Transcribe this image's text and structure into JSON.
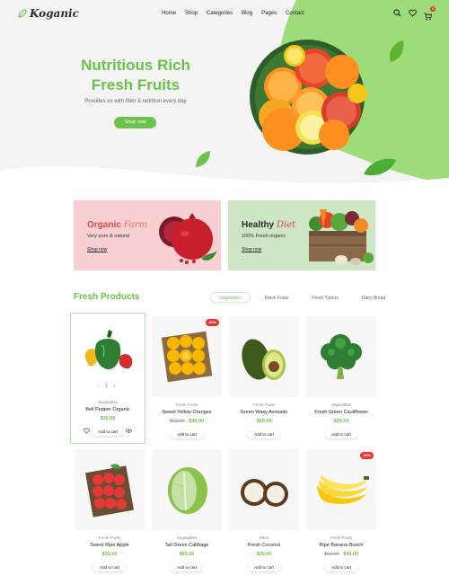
{
  "brand": {
    "name": "Koganic"
  },
  "nav": {
    "links": [
      "Home",
      "Shop",
      "Categories",
      "Blog",
      "Pages",
      "Contact"
    ],
    "cart_count": "0"
  },
  "hero": {
    "title_line1": "Nutritious Rich",
    "title_line2": "Fresh Fruits",
    "subtitle": "Provides us with fiber & nutrition every day",
    "button": "Shop now"
  },
  "banners": [
    {
      "title": "Organic",
      "script": "Farm",
      "subtitle": "Very pure & natural",
      "link": "Shop now"
    },
    {
      "title": "Healthy",
      "script": "Diet",
      "subtitle": "100% Fresh organic",
      "link": "Shop now"
    }
  ],
  "products_section": {
    "title": "Fresh Products",
    "tabs": [
      "Vegetables",
      "Fresh Fruits",
      "Fresh Tubers",
      "Dairy Bread"
    ],
    "active_tab": "Vegetables"
  },
  "products": [
    {
      "category": "Vegetables",
      "name": "Bell Pepper Organic",
      "price": "$35.00",
      "old_price": "",
      "badge": "",
      "qty": "1",
      "add": "Add to cart",
      "image": "bell-pepper"
    },
    {
      "category": "Fresh Fruits",
      "name": "Sweet Yellow Oranges",
      "price": "$49.00",
      "old_price": "$62.00",
      "badge": "-20%",
      "add": "Add to cart",
      "image": "oranges"
    },
    {
      "category": "Fresh Fruits",
      "name": "Green Waxy Avocado",
      "price": "$60.00",
      "old_price": "",
      "badge": "",
      "add": "Add to cart",
      "image": "avocado"
    },
    {
      "category": "Vegetables",
      "name": "Fresh Green Cauliflower",
      "price": "$29.00",
      "old_price": "",
      "badge": "",
      "add": "Add to cart",
      "image": "broccoli"
    },
    {
      "category": "Fresh Fruits",
      "name": "Sweet Ripe Apple",
      "price": "$35.00",
      "old_price": "",
      "badge": "",
      "add": "Add to cart",
      "image": "apples"
    },
    {
      "category": "Vegetables",
      "name": "Tall Green Cabbage",
      "price": "$60.00",
      "old_price": "",
      "badge": "",
      "add": "Add to cart",
      "image": "cabbage"
    },
    {
      "category": "Meat",
      "name": "Fresh Coconut",
      "price": "$29.00",
      "old_price": "",
      "badge": "",
      "add": "Add to cart",
      "image": "coconut"
    },
    {
      "category": "Fresh Fruits",
      "name": "Ripe Banana Bunch",
      "price": "$43.00",
      "old_price": "$62.00",
      "badge": "-22%",
      "add": "Add to cart",
      "image": "banana"
    }
  ],
  "colors": {
    "accent": "#6cc24a",
    "sale": "#e53935",
    "organic_bg": "#f8cfd2",
    "healthy_bg": "#cde7c5"
  }
}
